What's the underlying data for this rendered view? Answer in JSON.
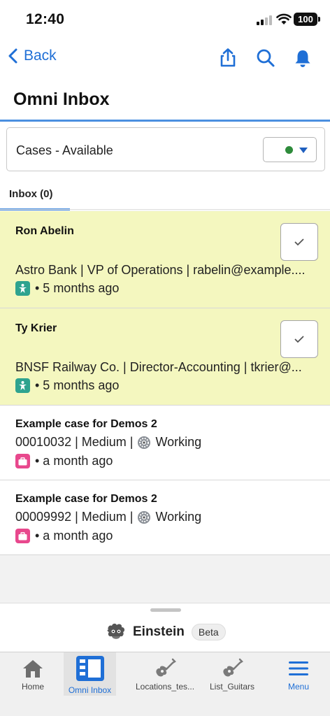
{
  "status_bar": {
    "time": "12:40",
    "battery": "100"
  },
  "nav": {
    "back_label": "Back"
  },
  "page": {
    "title": "Omni Inbox"
  },
  "filter": {
    "label": "Cases - Available",
    "status_color": "#2e8b3b"
  },
  "tab": {
    "label": "Inbox (0)"
  },
  "work_items": [
    {
      "title": "Ron Abelin",
      "subtitle": "Astro Bank | VP of Operations | rabelin@example....",
      "meta": "• 5 months ago",
      "icon": "contact-icon"
    },
    {
      "title": "Ty Krier",
      "subtitle": "BNSF Railway Co. | Director-Accounting | tkrier@...",
      "meta": "• 5 months ago",
      "icon": "contact-icon"
    }
  ],
  "cases": [
    {
      "title": "Example case for Demos 2",
      "number_priority": "00010032 | Medium |",
      "status": "Working",
      "meta": "• a month ago",
      "icon": "briefcase-icon"
    },
    {
      "title": "Example case for Demos 2",
      "number_priority": "00009992 | Medium |",
      "status": "Working",
      "meta": "• a month ago",
      "icon": "briefcase-icon"
    }
  ],
  "einstein": {
    "label": "Einstein",
    "badge": "Beta"
  },
  "tab_bar": [
    {
      "label": "Home",
      "icon": "home-icon"
    },
    {
      "label": "Omni Inbox",
      "icon": "omni-inbox-icon"
    },
    {
      "label": "Locations_tes...",
      "icon": "guitar-icon"
    },
    {
      "label": "List_Guitars",
      "icon": "guitar-icon"
    },
    {
      "label": "Menu",
      "icon": "menu-icon"
    }
  ],
  "colors": {
    "accent": "#1f6fd6",
    "highlight_row": "#f4f7bf",
    "teal_badge": "#2ea38f",
    "pink_badge": "#e8488d"
  }
}
